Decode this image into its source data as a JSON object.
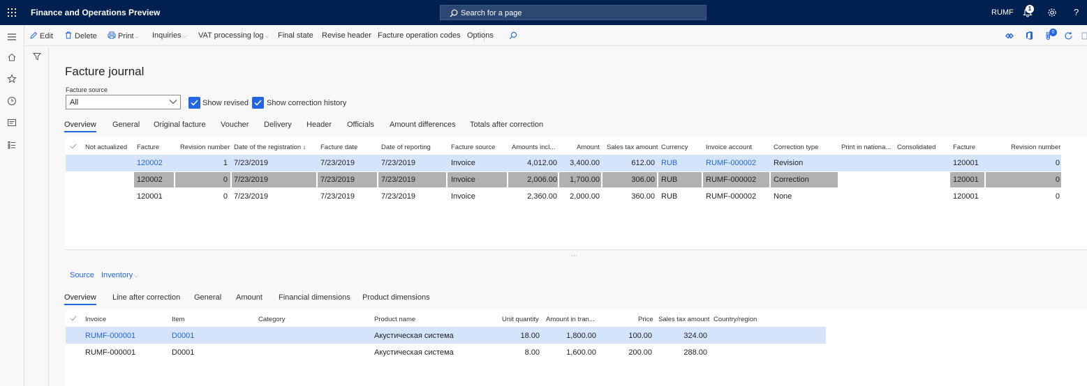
{
  "topbar": {
    "title": "Finance and Operations Preview",
    "search_placeholder": "Search for a page",
    "company": "RUMF",
    "notification_count": "1",
    "help": "?"
  },
  "actions": {
    "edit": "Edit",
    "delete": "Delete",
    "print": "Print",
    "inquiries": "Inquiries",
    "vat_log": "VAT processing log",
    "final_state": "Final state",
    "revise_header": "Revise header",
    "facture_op_codes": "Facture operation codes",
    "options": "Options",
    "attach_count": "0"
  },
  "page": {
    "title": "Facture journal",
    "facture_source_label": "Facture source",
    "facture_source_value": "All",
    "show_revised": "Show revised",
    "show_correction_history": "Show correction history"
  },
  "tabs1": [
    "Overview",
    "General",
    "Original facture",
    "Voucher",
    "Delivery",
    "Header",
    "Officials",
    "Amount differences",
    "Totals after correction"
  ],
  "grid1": {
    "headers": [
      "Not actualized",
      "Facture",
      "Revision number",
      "Date of the registration ↓",
      "Facture date",
      "Date of reporting",
      "Facture source",
      "Amounts incl...",
      "Amount",
      "Sales tax amount",
      "Currency",
      "Invoice account",
      "Correction type",
      "Print in nationa...",
      "Consolidated",
      "Facture",
      "Revision number"
    ],
    "rows": [
      [
        "",
        "120002",
        "1",
        "7/23/2019",
        "7/23/2019",
        "7/23/2019",
        "Invoice",
        "4,012.00",
        "3,400.00",
        "612.00",
        "RUB",
        "RUMF-000002",
        "Revision",
        "",
        "",
        "120001",
        "0"
      ],
      [
        "",
        "120002",
        "0",
        "7/23/2019",
        "7/23/2019",
        "7/23/2019",
        "Invoice",
        "2,006.00",
        "1,700.00",
        "306.00",
        "RUB",
        "RUMF-000002",
        "Correction",
        "",
        "",
        "120001",
        "0"
      ],
      [
        "",
        "120001",
        "0",
        "7/23/2019",
        "7/23/2019",
        "7/23/2019",
        "Invoice",
        "2,360.00",
        "2,000.00",
        "360.00",
        "RUB",
        "RUMF-000002",
        "None",
        "",
        "",
        "120001",
        "0"
      ]
    ]
  },
  "lines": {
    "source": "Source",
    "inventory": "Inventory"
  },
  "tabs2": [
    "Overview",
    "Line after correction",
    "General",
    "Amount",
    "Financial dimensions",
    "Product dimensions"
  ],
  "grid2": {
    "headers": [
      "Invoice",
      "Item",
      "Category",
      "Product name",
      "Unit quantity",
      "Amount in tran...",
      "Price",
      "Sales tax amount",
      "Country/region"
    ],
    "rows": [
      [
        "RUMF-000001",
        "D0001",
        "",
        "Акустическая система",
        "18.00",
        "1,800.00",
        "100.00",
        "324.00",
        ""
      ],
      [
        "RUMF-000001",
        "D0001",
        "",
        "Акустическая система",
        "8.00",
        "1,600.00",
        "200.00",
        "288.00",
        ""
      ]
    ]
  },
  "colors": {
    "nav_bar": "#002050",
    "accent": "#2266e3",
    "selected_row": "#d6e4fb",
    "gray_row": "#b1b1b1"
  }
}
